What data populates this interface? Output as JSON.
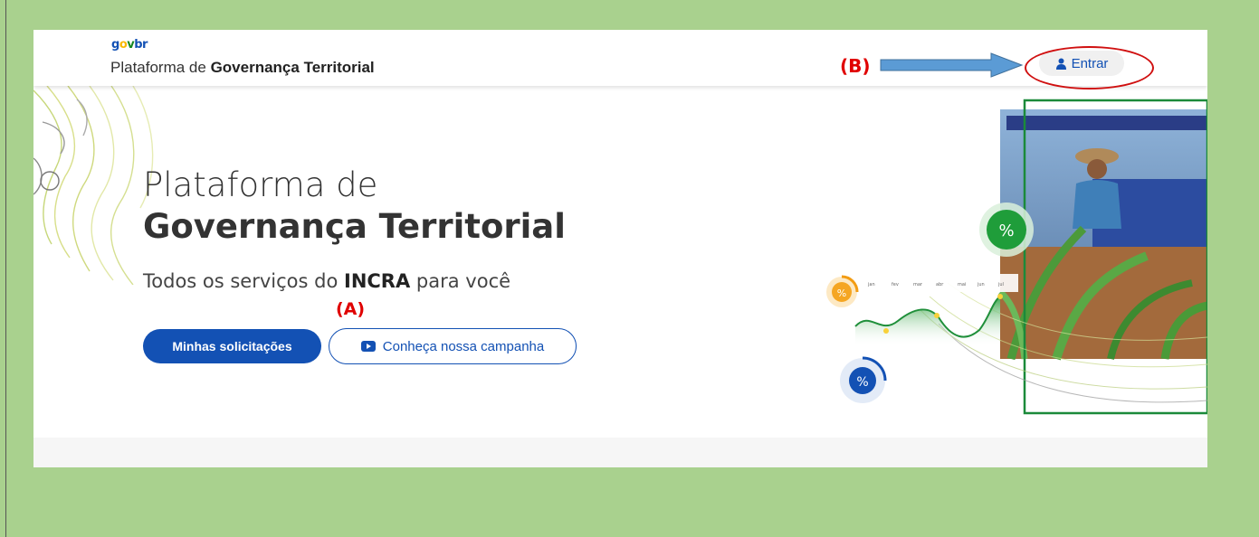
{
  "header": {
    "logo": {
      "g": "g",
      "o": "o",
      "v": "v",
      "b": "br"
    },
    "platform_prefix": "Plataforma de",
    "platform_bold": "Governança Territorial",
    "login_label": "Entrar"
  },
  "hero": {
    "title_line1": "Plataforma de",
    "title_line2": "Governança Territorial",
    "subtitle_prefix": "Todos os serviços do",
    "subtitle_bold": "INCRA",
    "subtitle_suffix": "para você",
    "primary_button": "Minhas solicitações",
    "secondary_button": "Conheça nossa campanha"
  },
  "annotations": {
    "a": "(A)",
    "b": "(B)"
  },
  "illustration": {
    "badge_symbol": "%",
    "months": [
      "jan",
      "fev",
      "mar",
      "abr",
      "mai",
      "jun",
      "jul"
    ]
  },
  "colors": {
    "page_background": "#a9d18e",
    "primary_blue": "#1351b4",
    "annotation_red": "#e00000",
    "green": "#168821",
    "orange": "#f8b802"
  },
  "icons": {
    "user": "user-icon",
    "video": "video-icon",
    "arrow": "arrow-right-icon"
  }
}
